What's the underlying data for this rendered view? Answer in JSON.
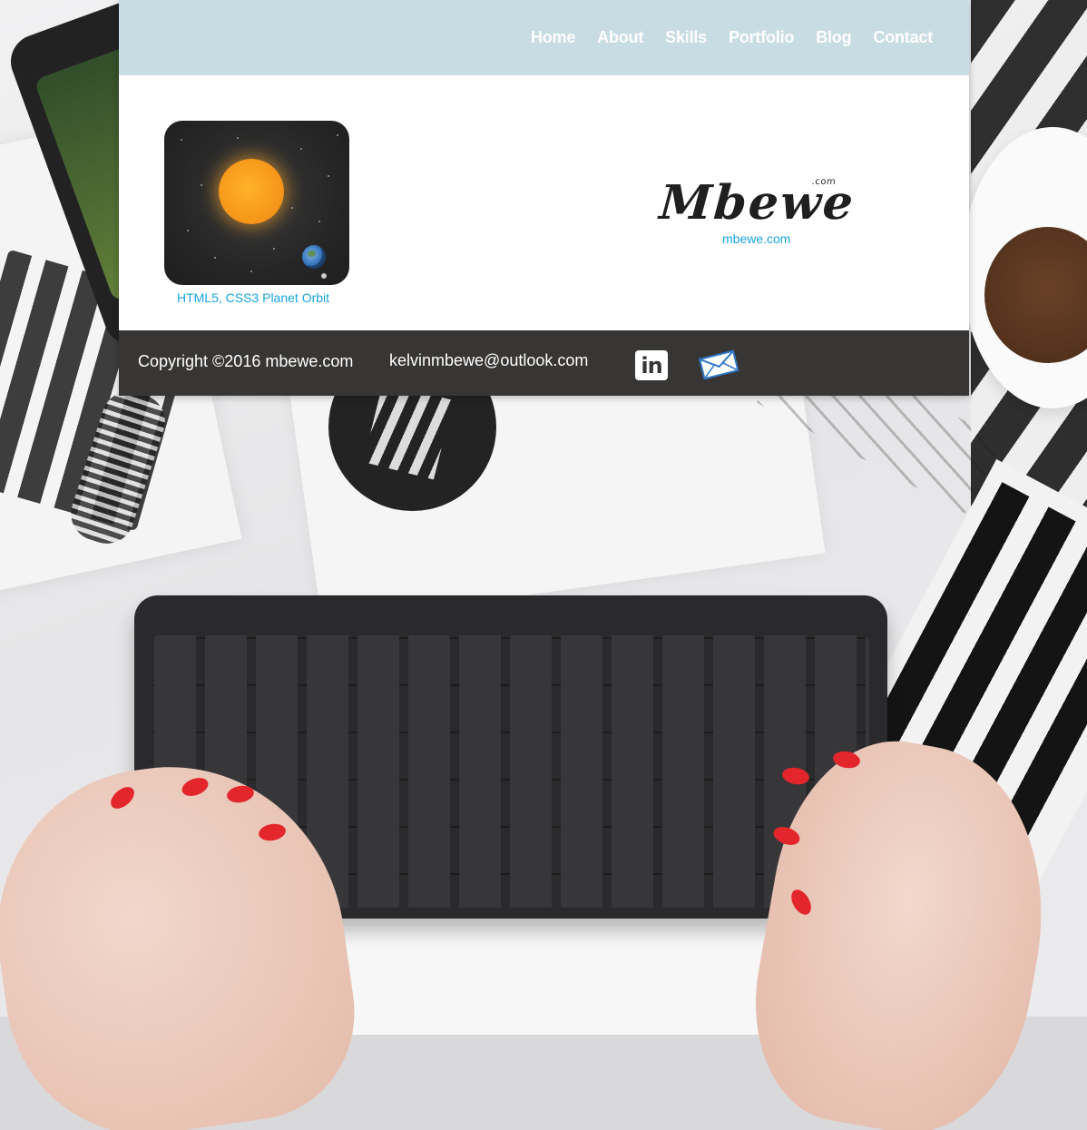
{
  "nav": {
    "items": [
      {
        "label": "Home"
      },
      {
        "label": "About"
      },
      {
        "label": "Skills"
      },
      {
        "label": "Portfolio"
      },
      {
        "label": "Blog"
      },
      {
        "label": "Contact"
      }
    ]
  },
  "projects": [
    {
      "caption": "HTML5, CSS3 Planet Orbit",
      "thumbnail_icon": "planet-orbit-thumbnail"
    }
  ],
  "brand": {
    "logo_text": "Mbewe",
    "logo_suffix": ".com",
    "link_label": "mbewe.com"
  },
  "footer": {
    "copyright": "Copyright ©2016 mbewe.com",
    "email": "kelvinmbewe@outlook.com",
    "linkedin_icon_text": "in",
    "social_icons": [
      "linkedin-icon",
      "mail-icon"
    ]
  },
  "colors": {
    "nav_bg": "#c8dce4",
    "footer_bg": "#383634",
    "link": "#19a4e0"
  }
}
